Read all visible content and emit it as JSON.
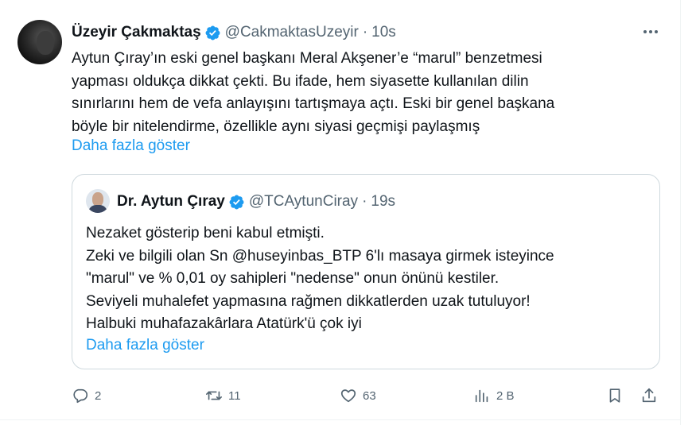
{
  "tweet": {
    "author_name": "Üzeyir Çakmaktaş",
    "handle": "@CakmaktasUzeyir",
    "separator": "·",
    "time": "10s",
    "text_lines": [
      "Aytun Çıray’ın eski genel başkanı Meral Akşener’e “marul” benzetmesi",
      "yapması oldukça dikkat çekti. Bu ifade, hem siyasette kullanılan dilin",
      "sınırlarını hem de vefa anlayışını tartışmaya açtı. Eski bir genel başkana",
      "böyle bir nitelendirme, özellikle aynı siyasi geçmişi paylaşmış"
    ],
    "show_more": "Daha fazla göster"
  },
  "quote": {
    "author_name": "Dr. Aytun Çıray",
    "handle": "@TCAytunCiray",
    "separator": "·",
    "time": "19s",
    "text_lines": [
      "Nezaket gösterip beni kabul etmişti.",
      "Zeki ve bilgili olan Sn @huseyinbas_BTP 6'lı masaya girmek isteyince",
      "\"marul\" ve % 0,01 oy sahipleri \"nedense\" onun önünü kestiler.",
      "Seviyeli muhalefet yapmasına rağmen dikkatlerden uzak tutuluyor!",
      "Halbuki muhafazakârlara Atatürk'ü çok iyi"
    ],
    "show_more": "Daha fazla göster"
  },
  "actions": {
    "replies": "2",
    "reposts": "11",
    "likes": "63",
    "views": "2 B"
  },
  "icons": [
    "verified-badge-icon",
    "more-icon",
    "reply-icon",
    "repost-icon",
    "like-icon",
    "views-icon",
    "bookmark-icon",
    "share-icon"
  ],
  "colors": {
    "text": "#0f1419",
    "secondary": "#536471",
    "link": "#1d9bf0",
    "verified": "#1d9bf0",
    "border": "#cfd9de"
  }
}
